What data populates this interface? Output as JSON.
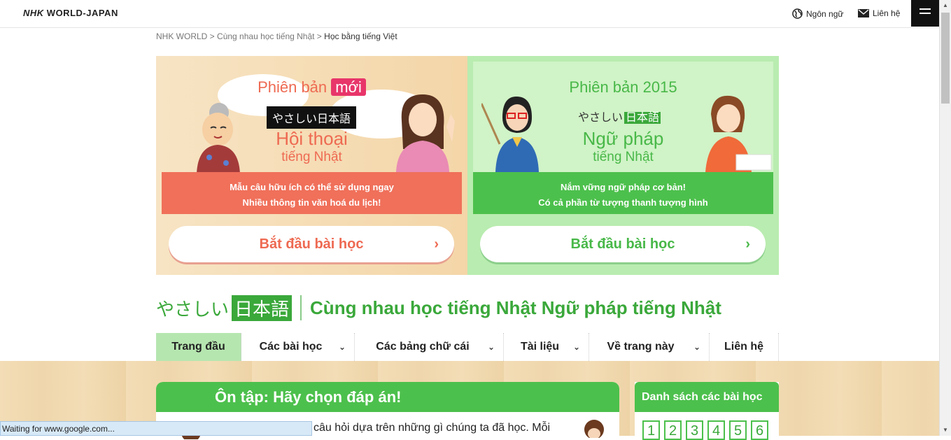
{
  "header": {
    "logo_bold": "NHK",
    "logo_rest": "WORLD-JAPAN",
    "language_label": "Ngôn ngữ",
    "contact_label": "Liên hệ"
  },
  "breadcrumb": {
    "item1": "NHK WORLD",
    "sep1": " > ",
    "item2": "Cùng nhau học tiếng Nhật",
    "sep2": " > ",
    "current": "Học bằng tiếng Việt"
  },
  "banner": {
    "left": {
      "version_prefix": "Phiên bản",
      "version_badge": "mới",
      "yasashii": "やさしい日本語",
      "title": "Hội thoại",
      "subtitle": "tiếng Nhật",
      "desc_line1": "Mẫu câu hữu ích có thể sử dụng ngay",
      "desc_line2": "Nhiều thông tin văn hoá du lịch!",
      "button": "Bắt đầu bài học",
      "chevron": "›"
    },
    "right": {
      "version": "Phiên bản 2015",
      "yasashii_kana": "やさしい",
      "yasashii_kanji": "日本語",
      "title": "Ngữ pháp",
      "subtitle": "tiếng Nhật",
      "desc_line1": "Nắm vững ngữ pháp cơ bản!",
      "desc_line2": "Có cả phần từ tượng thanh tượng hình",
      "button": "Bắt đầu bài học",
      "chevron": "›"
    }
  },
  "site_title": {
    "kana": "やさしい",
    "kanji": "日本語",
    "text": "Cùng nhau học tiếng Nhật Ngữ pháp tiếng Nhật"
  },
  "nav": {
    "items": [
      {
        "label": "Trang đầu",
        "dropdown": ""
      },
      {
        "label": "Các bài học",
        "dropdown": "⌄"
      },
      {
        "label": "Các bảng chữ cái",
        "dropdown": "⌄"
      },
      {
        "label": "Tài liệu",
        "dropdown": "⌄"
      },
      {
        "label": "Về trang này",
        "dropdown": "⌄"
      },
      {
        "label": "Liên hệ",
        "dropdown": ""
      }
    ]
  },
  "quiz": {
    "heading": "Ôn tập: Hãy chọn đáp án!",
    "body": "câu hỏi dựa trên những gì chúng ta đã học. Mỗi"
  },
  "lesson_list": {
    "heading": "Danh sách các bài học",
    "numbers": [
      "1",
      "2",
      "3",
      "4",
      "5",
      "6"
    ]
  },
  "status_bar": {
    "text": "Waiting for www.google.com..."
  },
  "colors": {
    "green": "#4cc04c",
    "coral": "#f0705a",
    "pink_badge": "#e8356a"
  }
}
